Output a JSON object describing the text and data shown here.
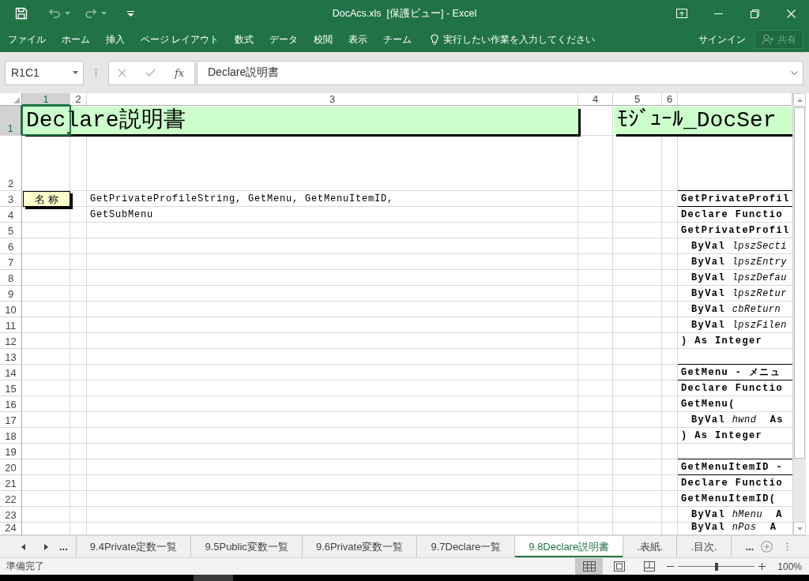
{
  "window": {
    "title": "DocAcs.xls  [保護ビュー] - Excel"
  },
  "quick_access": [
    {
      "kind": "save",
      "disabled": false
    },
    {
      "kind": "undo",
      "disabled": true
    },
    {
      "kind": "redo",
      "disabled": true
    },
    {
      "kind": "customize",
      "disabled": false
    }
  ],
  "ribbon": {
    "tabs": [
      {
        "label": "ファイル",
        "selected": false
      },
      {
        "label": "ホーム",
        "selected": false
      },
      {
        "label": "挿入",
        "selected": false
      },
      {
        "label": "ページ レイアウト",
        "selected": false
      },
      {
        "label": "数式",
        "selected": false
      },
      {
        "label": "データ",
        "selected": false
      },
      {
        "label": "校閲",
        "selected": false
      },
      {
        "label": "表示",
        "selected": false
      },
      {
        "label": "チーム",
        "selected": false
      }
    ],
    "tell_me": {
      "placeholder": "実行したい作業を入力してください"
    },
    "sign_in": "サインイン",
    "share": {
      "label": "共有",
      "disabled": true
    }
  },
  "formula_bar": {
    "name_box": "R1C1",
    "edit_buttons": [
      {
        "kind": "cancel",
        "disabled": true
      },
      {
        "kind": "enter",
        "disabled": true
      }
    ],
    "insert_function": "fx",
    "formula": "Declare説明書"
  },
  "sheet": {
    "columns": [
      {
        "label": "1",
        "selected": true
      },
      {
        "label": "2",
        "selected": false
      },
      {
        "label": "3",
        "selected": false
      },
      {
        "label": "4",
        "selected": false
      },
      {
        "label": "5",
        "selected": false
      },
      {
        "label": "6",
        "selected": false
      },
      {
        "selected": false
      }
    ],
    "rows": [
      {
        "label": "1",
        "selected": true
      },
      {
        "label": "2",
        "selected": false
      },
      {
        "label": "3",
        "selected": false
      },
      {
        "label": "4",
        "selected": false
      },
      {
        "label": "5",
        "selected": false
      },
      {
        "label": "6",
        "selected": false
      },
      {
        "label": "7",
        "selected": false
      },
      {
        "label": "8",
        "selected": false
      },
      {
        "label": "9",
        "selected": false
      },
      {
        "label": "10",
        "selected": false
      },
      {
        "label": "11",
        "selected": false
      },
      {
        "label": "12",
        "selected": false
      },
      {
        "label": "13",
        "selected": false
      },
      {
        "label": "14",
        "selected": false
      },
      {
        "label": "15",
        "selected": false
      },
      {
        "label": "16",
        "selected": false
      },
      {
        "label": "17",
        "selected": false
      },
      {
        "label": "18",
        "selected": false
      },
      {
        "label": "19",
        "selected": false
      },
      {
        "label": "20",
        "selected": false
      },
      {
        "label": "21",
        "selected": false
      },
      {
        "label": "22",
        "selected": false
      },
      {
        "label": "23",
        "selected": false
      },
      {
        "label": "24",
        "selected": false
      }
    ],
    "titles": [
      "Declare説明書",
      "ﾓｼﾞｭｰﾙ_DocSer"
    ],
    "name_tag": "名 称",
    "names": [
      "GetPrivateProfileString, GetMenu, GetMenuItemID,",
      "GetSubMenu"
    ],
    "declarations": [
      {
        "heading": "GetPrivateProfil",
        "lines": [
          {
            "kind": "code",
            "text": "Declare Functio"
          },
          {
            "kind": "code",
            "text": "GetPrivateProfil"
          },
          {
            "kind": "param",
            "text": "**ByVal** *lpszSecti*"
          },
          {
            "kind": "param",
            "text": "**ByVal** *lpszEntry*"
          },
          {
            "kind": "param",
            "text": "**ByVal** *lpszDefau*"
          },
          {
            "kind": "param",
            "text": "**ByVal** *lpszRetur*"
          },
          {
            "kind": "param",
            "text": "**ByVal** *cbReturn*"
          },
          {
            "kind": "param",
            "text": "**ByVal** *lpszFilen*"
          },
          {
            "kind": "code",
            "text": ") As Integer"
          }
        ]
      },
      {
        "heading": "GetMenu - メニュ",
        "lines": [
          {
            "kind": "code",
            "text": "Declare Functio"
          },
          {
            "kind": "code",
            "text": "GetMenu("
          },
          {
            "kind": "param",
            "text": "**ByVal** *hwnd*  **As**"
          },
          {
            "kind": "code",
            "text": ") As Integer"
          }
        ]
      },
      {
        "heading": "GetMenuItemID -",
        "lines": [
          {
            "kind": "code",
            "text": "Declare Functio"
          },
          {
            "kind": "code",
            "text": "GetMenuItemID("
          },
          {
            "kind": "param",
            "text": "**ByVal** *hMenu*  **A**"
          },
          {
            "kind": "param",
            "text": "**ByVal** *nPos*  **A**"
          }
        ]
      }
    ]
  },
  "sheet_tabs": {
    "before": "...",
    "tabs": [
      {
        "label": "9.4Private定数一覧",
        "selected": false
      },
      {
        "label": "9.5Public変数一覧",
        "selected": false
      },
      {
        "label": "9.6Private変数一覧",
        "selected": false
      },
      {
        "label": "9.7Declare一覧",
        "selected": false
      },
      {
        "label": "9.8Declare説明書",
        "selected": true
      },
      {
        "label": ".表紙.",
        "selected": false
      },
      {
        "label": ".目次.",
        "selected": false
      }
    ],
    "after": "..."
  },
  "status_bar": {
    "status": "準備完了",
    "views": [
      {
        "kind": "normal",
        "selected": true
      },
      {
        "kind": "page_layout",
        "selected": false
      },
      {
        "kind": "page_break",
        "selected": false
      }
    ],
    "zoom": {
      "level": 0.5,
      "reading": "100%"
    }
  }
}
